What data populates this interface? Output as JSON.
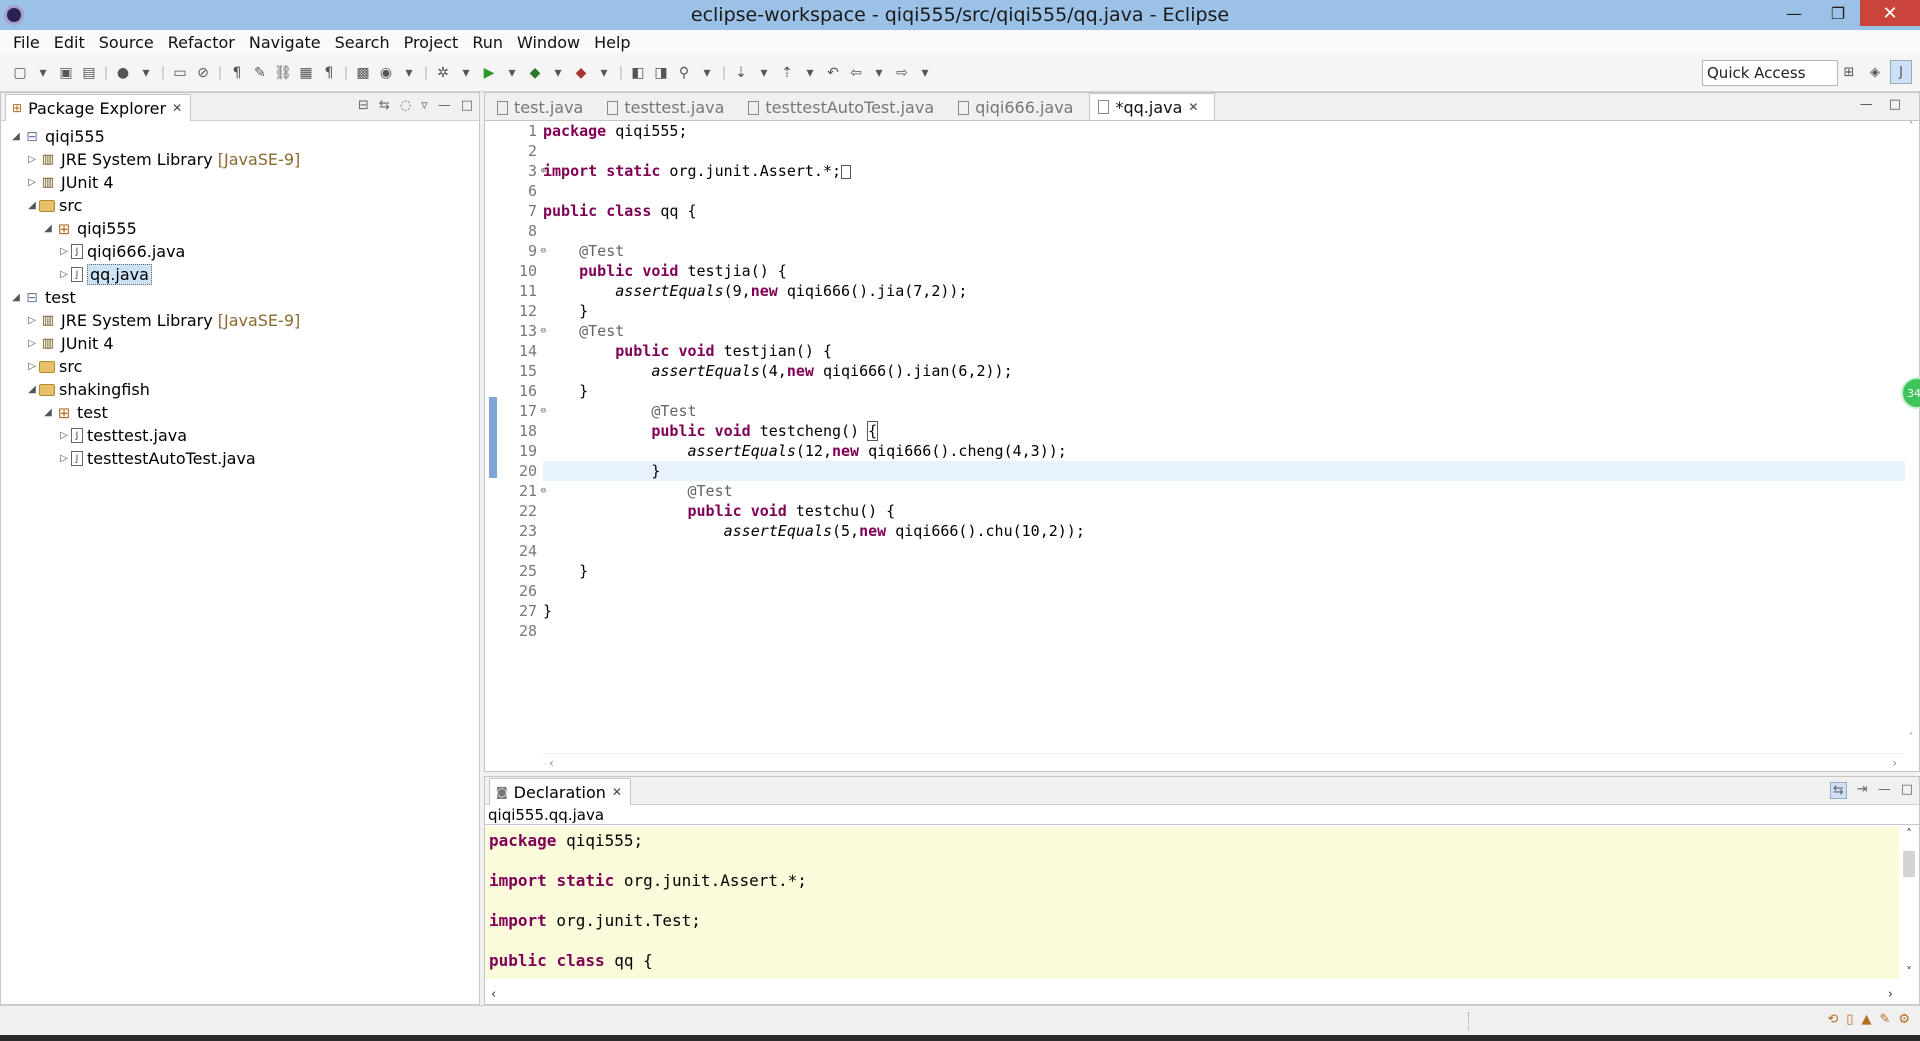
{
  "window": {
    "title": "eclipse-workspace - qiqi555/src/qiqi555/qq.java - Eclipse"
  },
  "menu": [
    "File",
    "Edit",
    "Source",
    "Refactor",
    "Navigate",
    "Search",
    "Project",
    "Run",
    "Window",
    "Help"
  ],
  "toolbar": {
    "quick_access": "Quick Access"
  },
  "package_explorer": {
    "title": "Package Explorer",
    "tree": [
      {
        "label": "qiqi555",
        "icon": "project-icon",
        "indent": 0,
        "arrow": "◢",
        "deco": ""
      },
      {
        "label": "JRE System Library",
        "icon": "library-icon",
        "indent": 1,
        "arrow": "▷",
        "deco": "[JavaSE-9]"
      },
      {
        "label": "JUnit 4",
        "icon": "library-icon",
        "indent": 1,
        "arrow": "▷",
        "deco": ""
      },
      {
        "label": "src",
        "icon": "source-folder-icon",
        "indent": 1,
        "arrow": "◢",
        "deco": ""
      },
      {
        "label": "qiqi555",
        "icon": "package-icon",
        "indent": 2,
        "arrow": "◢",
        "deco": ""
      },
      {
        "label": "qiqi666.java",
        "icon": "java-file-icon",
        "indent": 3,
        "arrow": "▷",
        "deco": ""
      },
      {
        "label": "qq.java",
        "icon": "java-file-icon",
        "indent": 3,
        "arrow": "▷",
        "deco": "",
        "selected": true
      },
      {
        "label": "test",
        "icon": "project-icon",
        "indent": 0,
        "arrow": "◢",
        "deco": ""
      },
      {
        "label": "JRE System Library",
        "icon": "library-icon",
        "indent": 1,
        "arrow": "▷",
        "deco": "[JavaSE-9]"
      },
      {
        "label": "JUnit 4",
        "icon": "library-icon",
        "indent": 1,
        "arrow": "▷",
        "deco": ""
      },
      {
        "label": "src",
        "icon": "source-folder-icon",
        "indent": 1,
        "arrow": "▷",
        "deco": ""
      },
      {
        "label": "shakingfish",
        "icon": "source-folder-icon",
        "indent": 1,
        "arrow": "◢",
        "deco": ""
      },
      {
        "label": "test",
        "icon": "package-icon",
        "indent": 2,
        "arrow": "◢",
        "deco": ""
      },
      {
        "label": "testtest.java",
        "icon": "java-file-icon",
        "indent": 3,
        "arrow": "▷",
        "deco": ""
      },
      {
        "label": "testtestAutoTest.java",
        "icon": "java-file-icon",
        "indent": 3,
        "arrow": "▷",
        "deco": ""
      }
    ]
  },
  "editor": {
    "tabs": [
      {
        "label": "test.java",
        "active": false
      },
      {
        "label": "testtest.java",
        "active": false
      },
      {
        "label": "testtestAutoTest.java",
        "active": false
      },
      {
        "label": "qiqi666.java",
        "active": false
      },
      {
        "label": "*qq.java",
        "active": true
      }
    ],
    "lines": [
      {
        "n": "1",
        "code": "package qiqi555;"
      },
      {
        "n": "2",
        "code": ""
      },
      {
        "n": "3",
        "code": "import static org.junit.Assert.*;",
        "fold": "⊕",
        "boxed": true
      },
      {
        "n": "6",
        "code": ""
      },
      {
        "n": "7",
        "code": "public class qq {"
      },
      {
        "n": "8",
        "code": ""
      },
      {
        "n": "9",
        "code": "    @Test",
        "fold": "⊖"
      },
      {
        "n": "10",
        "code": "    public void testjia() {"
      },
      {
        "n": "11",
        "code": "        assertEquals(9,new qiqi666().jia(7,2));"
      },
      {
        "n": "12",
        "code": "    }"
      },
      {
        "n": "13",
        "code": "    @Test",
        "fold": "⊖"
      },
      {
        "n": "14",
        "code": "        public void testjian() {"
      },
      {
        "n": "15",
        "code": "            assertEquals(4,new qiqi666().jian(6,2));"
      },
      {
        "n": "16",
        "code": "    }"
      },
      {
        "n": "17",
        "code": "            @Test",
        "fold": "⊖"
      },
      {
        "n": "18",
        "code": "            public void testcheng() {"
      },
      {
        "n": "19",
        "code": "                assertEquals(12,new qiqi666().cheng(4,3));"
      },
      {
        "n": "20",
        "code": "            }",
        "current": true
      },
      {
        "n": "21",
        "code": "                @Test",
        "fold": "⊖"
      },
      {
        "n": "22",
        "code": "                public void testchu() {"
      },
      {
        "n": "23",
        "code": "                    assertEquals(5,new qiqi666().chu(10,2));"
      },
      {
        "n": "24",
        "code": ""
      },
      {
        "n": "25",
        "code": "    }"
      },
      {
        "n": "26",
        "code": ""
      },
      {
        "n": "27",
        "code": "}"
      },
      {
        "n": "28",
        "code": ""
      }
    ],
    "badge": "34"
  },
  "declaration": {
    "title": "Declaration",
    "path": "qiqi555.qq.java",
    "lines": [
      "package qiqi555;",
      "",
      "import static org.junit.Assert.*;",
      "",
      "import org.junit.Test;",
      "",
      "public class qq {"
    ]
  }
}
